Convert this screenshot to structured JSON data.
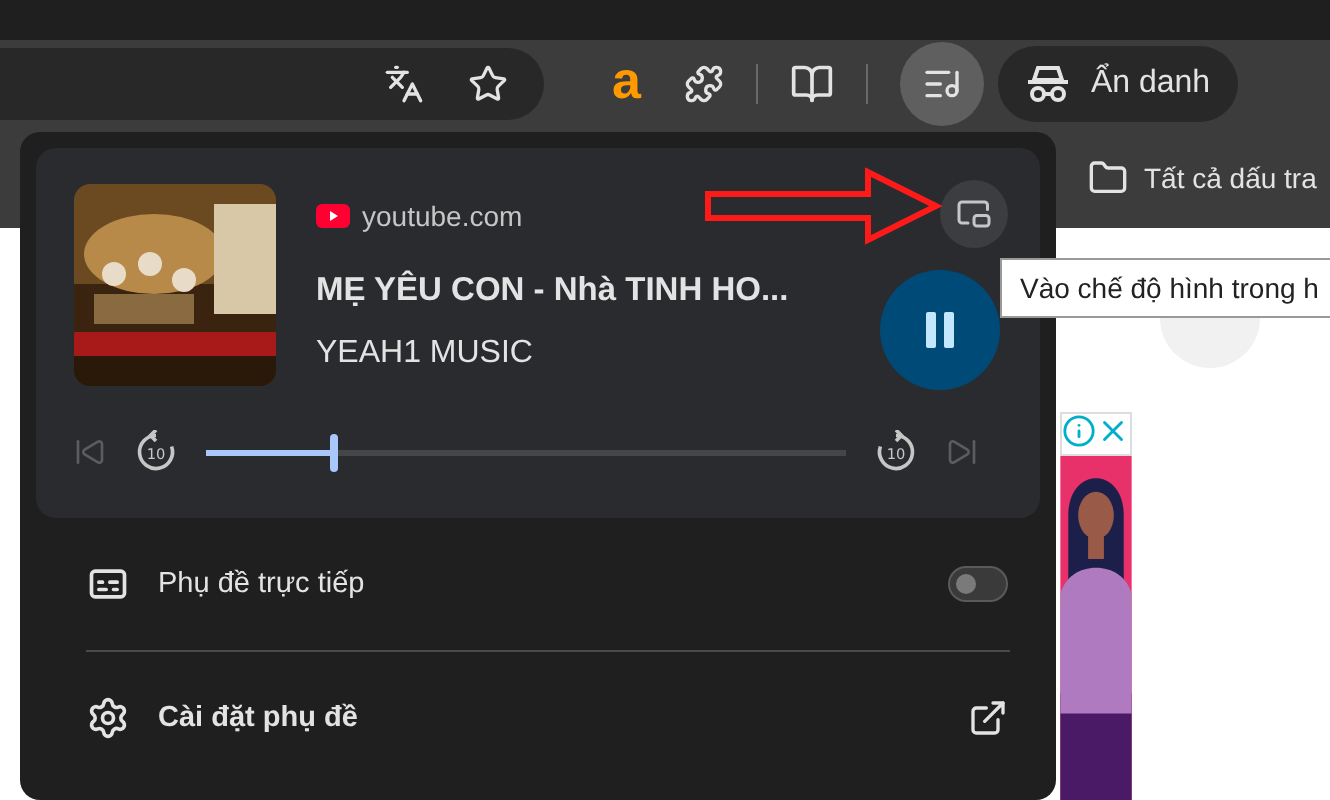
{
  "toolbar": {
    "extension_letter": "a",
    "incognito_label": "Ẩn danh"
  },
  "bookmarks": [
    {
      "label": "Tất cả dấu tra"
    }
  ],
  "media": {
    "source": "youtube.com",
    "title": "MẸ YÊU CON - Nhà TINH HO...",
    "artist": "YEAH1 MUSIC",
    "playing": true,
    "seek_back_label": "10",
    "seek_forward_label": "10",
    "progress": {
      "level": 0.2
    }
  },
  "live_caption": {
    "label": "Phụ đề trực tiếp",
    "on": false
  },
  "caption_settings": {
    "label": "Cài đặt phụ đề"
  },
  "tooltip": "Vào chế độ hình trong h"
}
